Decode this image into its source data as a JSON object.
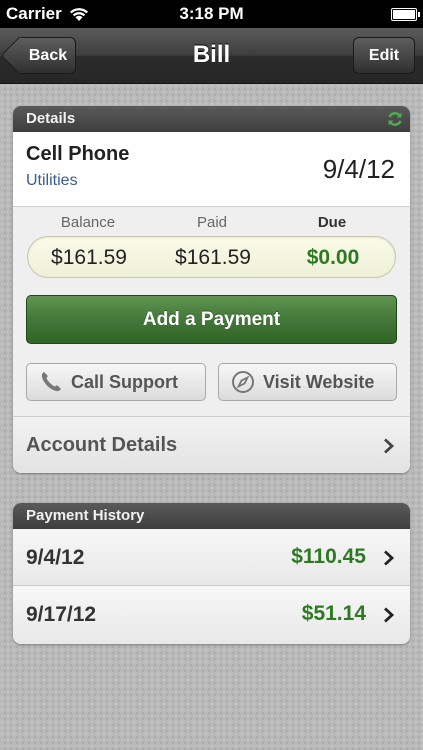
{
  "status_bar": {
    "carrier": "Carrier",
    "time": "3:18 PM"
  },
  "nav": {
    "title": "Bill",
    "back_label": "Back",
    "edit_label": "Edit"
  },
  "details": {
    "header": "Details",
    "bill_name": "Cell Phone",
    "category": "Utilities",
    "date": "9/4/12",
    "labels": {
      "balance": "Balance",
      "paid": "Paid",
      "due": "Due"
    },
    "values": {
      "balance": "$161.59",
      "paid": "$161.59",
      "due": "$0.00"
    },
    "add_payment_label": "Add a Payment",
    "call_support_label": "Call Support",
    "visit_website_label": "Visit Website",
    "account_details_label": "Account Details"
  },
  "history": {
    "header": "Payment History",
    "rows": [
      {
        "date": "9/4/12",
        "amount": "$110.45"
      },
      {
        "date": "9/17/12",
        "amount": "$51.14"
      }
    ]
  },
  "colors": {
    "accent_green": "#2d7a22",
    "payment_button": "#43783a",
    "category_blue": "#3a5d8c",
    "refresh_green": "#4caf50"
  },
  "icons": {
    "wifi": "wifi-icon",
    "battery": "battery-icon",
    "refresh": "refresh-icon",
    "phone": "phone-icon",
    "compass": "compass-icon",
    "chevron": "chevron-right-icon"
  }
}
